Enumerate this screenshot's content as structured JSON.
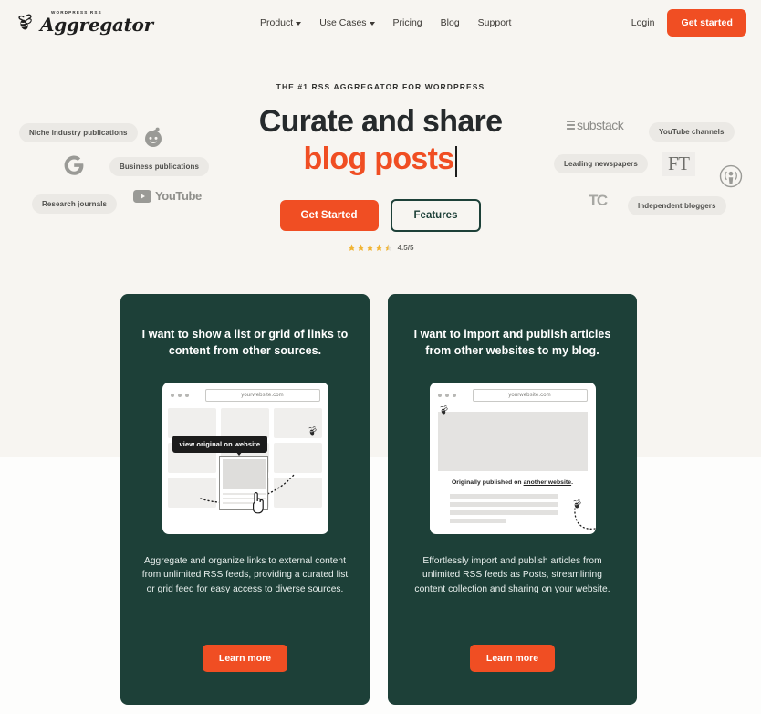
{
  "brand": {
    "kicker": "WORDPRESS RSS",
    "name": "Aggregator",
    "logo_icon": "bee-icon"
  },
  "colors": {
    "accent_orange": "#f04e23",
    "dark_green": "#1d4038",
    "hero_bg": "#f7f5f1",
    "chip_bg": "#ebe9e5",
    "heading": "#262a2c"
  },
  "header": {
    "nav": [
      {
        "label": "Product",
        "has_caret": true
      },
      {
        "label": "Use Cases",
        "has_caret": true
      },
      {
        "label": "Pricing",
        "has_caret": false
      },
      {
        "label": "Blog",
        "has_caret": false
      },
      {
        "label": "Support",
        "has_caret": false
      }
    ],
    "login_label": "Login",
    "cta_label": "Get started"
  },
  "hero": {
    "eyebrow": "THE #1 RSS AGGREGATOR FOR WORDPRESS",
    "heading_line1": "Curate and share",
    "heading_line2": "blog posts",
    "primary_cta": "Get Started",
    "secondary_cta": "Features",
    "rating_value": "4.5/5",
    "rating_stars": 4.5,
    "rating_stars_max": 5
  },
  "sources_left": {
    "chips": [
      "Niche industry publications",
      "Business publications",
      "Research journals"
    ],
    "logos": [
      "reddit-logo",
      "google-logo",
      "youtube-logo"
    ],
    "youtube_text": "YouTube"
  },
  "sources_right": {
    "chips": [
      "YouTube channels",
      "Leading newspapers",
      "Independent bloggers"
    ],
    "substack_text": "substack",
    "ft_text": "FT",
    "techcrunch_text": "TC",
    "logos": [
      "substack-logo",
      "ft-logo",
      "podcast-logo",
      "techcrunch-logo"
    ]
  },
  "cards": [
    {
      "title": "I want to show a list or grid of links to content from other sources.",
      "mock_url": "yourwebsite.com",
      "mock_tooltip": "view original on website",
      "description": "Aggregate and organize links to external content from unlimited RSS feeds, providing a curated list or grid feed for easy access to diverse sources.",
      "cta_label": "Learn more"
    },
    {
      "title": "I want to import and publish articles from other websites to my blog.",
      "mock_url": "yourwebsite.com",
      "mock_caption_prefix": "Originally published on ",
      "mock_caption_link": "another website",
      "mock_caption_suffix": ".",
      "description": "Effortlessly import and publish articles from unlimited RSS feeds as Posts, streamlining content collection and sharing on your website.",
      "cta_label": "Learn more"
    }
  ]
}
